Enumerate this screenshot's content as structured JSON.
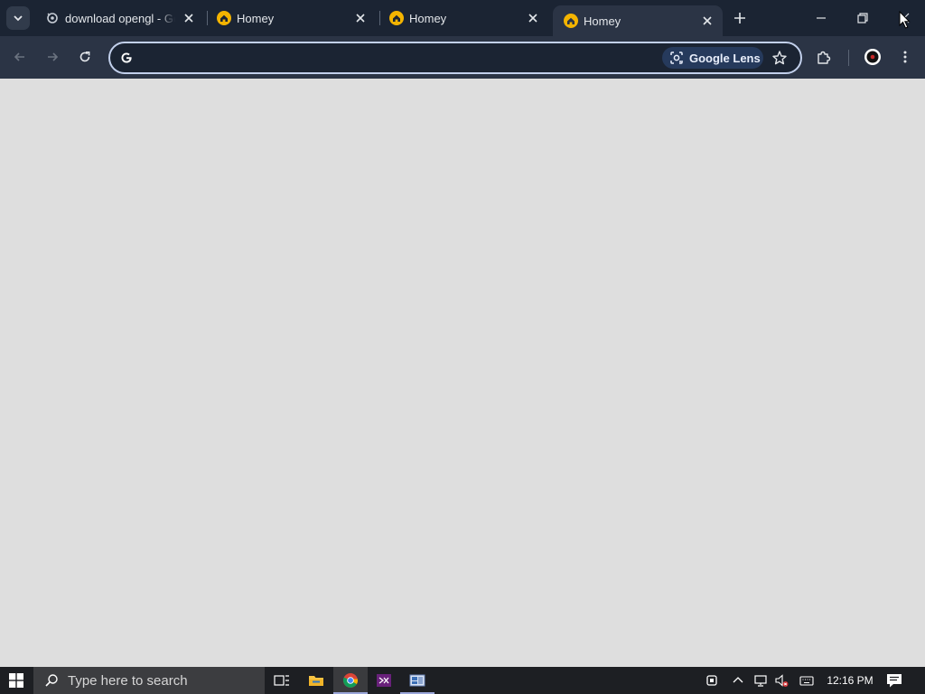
{
  "browser": {
    "tabs": [
      {
        "title": "download opengl - Go",
        "favicon": "chrome-search-icon",
        "active": false
      },
      {
        "title": "Homey",
        "favicon": "homey-icon",
        "active": false
      },
      {
        "title": "Homey",
        "favicon": "homey-icon",
        "active": false
      },
      {
        "title": "Homey",
        "favicon": "homey-icon",
        "active": true
      }
    ],
    "omnibox": {
      "value": "",
      "placeholder": "",
      "lens_label": "Google Lens"
    }
  },
  "taskbar": {
    "search_placeholder": "Type here to search",
    "clock": "12:16 PM",
    "apps": [
      "task-view-icon",
      "file-explorer-icon",
      "chrome-icon",
      "visual-studio-icon",
      "app-icon"
    ]
  },
  "colors": {
    "tabstrip": "#1b2433",
    "toolbar": "#2b3445",
    "page": "#dedede",
    "taskbar": "#1d1f23",
    "homey_favicon": "#f4b400"
  }
}
